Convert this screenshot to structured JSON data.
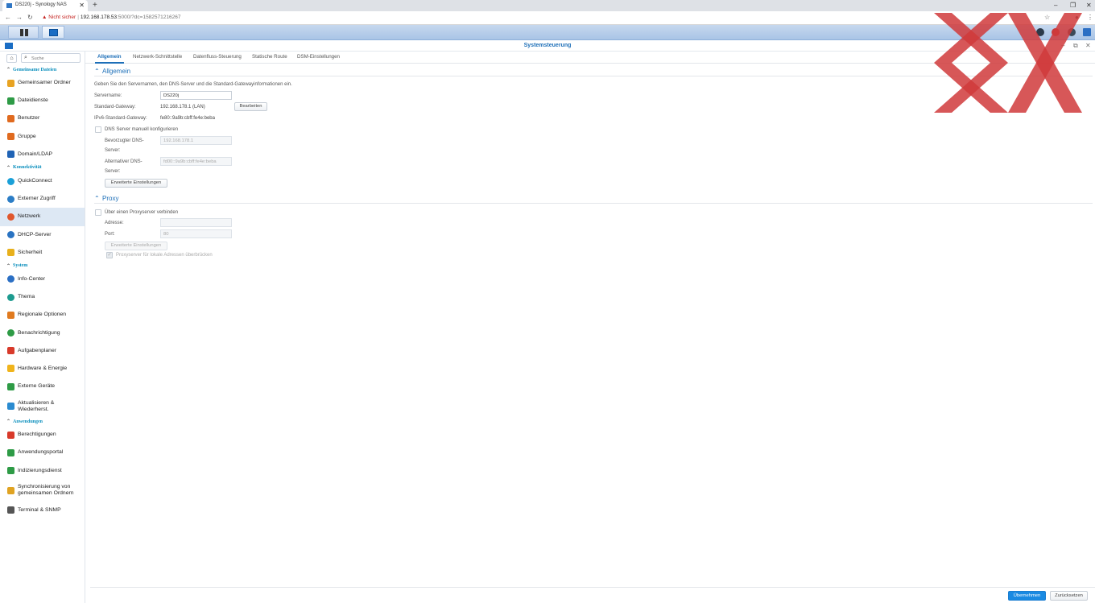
{
  "browser": {
    "tab_title": "DS220j - Synology NAS",
    "tab_close": "✕",
    "new_tab": "+",
    "window_controls": [
      "–",
      "❐",
      "✕"
    ],
    "security_label": "Nicht sicher",
    "url_host": "192.168.178.53",
    "url_rest": ":5000/?dc=1582571216267"
  },
  "window": {
    "title": "Systemsteuerung"
  },
  "sidebar": {
    "home_icon": "⌂",
    "search_placeholder": "Suche",
    "sections": [
      {
        "label": "Gemeinsame Dateien",
        "items": [
          {
            "label": "Gemeinsamer Ordner",
            "icon": "folder-icon",
            "color": "#e8a322"
          },
          {
            "label": "Dateidienste",
            "icon": "file-services-icon",
            "color": "#2e9b46"
          },
          {
            "label": "Benutzer",
            "icon": "user-icon",
            "color": "#e06a1f"
          },
          {
            "label": "Gruppe",
            "icon": "group-icon",
            "color": "#e06a1f"
          },
          {
            "label": "Domain/LDAP",
            "icon": "domain-icon",
            "color": "#2063b5"
          }
        ]
      },
      {
        "label": "Konnektivität",
        "items": [
          {
            "label": "QuickConnect",
            "icon": "quickconnect-icon",
            "color": "#1aa0d8"
          },
          {
            "label": "Externer Zugriff",
            "icon": "globe-icon",
            "color": "#2b7dc6"
          },
          {
            "label": "Netzwerk",
            "icon": "network-icon",
            "color": "#e0572d"
          },
          {
            "label": "DHCP-Server",
            "icon": "dhcp-icon",
            "color": "#2a73c2"
          },
          {
            "label": "Sicherheit",
            "icon": "shield-icon",
            "color": "#e8b01c"
          }
        ]
      },
      {
        "label": "System",
        "items": [
          {
            "label": "Info-Center",
            "icon": "info-icon",
            "color": "#2b6fc4"
          },
          {
            "label": "Thema",
            "icon": "theme-icon",
            "color": "#1d9b8f"
          },
          {
            "label": "Regionale Optionen",
            "icon": "regional-icon",
            "color": "#e07a1f"
          },
          {
            "label": "Benachrichtigung",
            "icon": "notification-icon",
            "color": "#2e9b46"
          },
          {
            "label": "Aufgabenplaner",
            "icon": "calendar-icon",
            "color": "#d83a2a"
          },
          {
            "label": "Hardware & Energie",
            "icon": "bulb-icon",
            "color": "#f0b41c"
          },
          {
            "label": "Externe Geräte",
            "icon": "external-device-icon",
            "color": "#2e9b46"
          },
          {
            "label": "Aktualisieren & Wiederherst.",
            "icon": "update-icon",
            "color": "#2a8bd0"
          }
        ]
      },
      {
        "label": "Anwendungen",
        "items": [
          {
            "label": "Berechtigungen",
            "icon": "privileges-icon",
            "color": "#d83a2a"
          },
          {
            "label": "Anwendungsportal",
            "icon": "portal-icon",
            "color": "#2e9b46"
          },
          {
            "label": "Indizierungsdienst",
            "icon": "index-icon",
            "color": "#2e9b46"
          },
          {
            "label": "Synchronisierung von gemeinsamen Ordnern",
            "icon": "sync-icon",
            "color": "#e0a322"
          },
          {
            "label": "Terminal & SNMP",
            "icon": "terminal-icon",
            "color": "#555555"
          }
        ]
      }
    ],
    "selected": "Netzwerk"
  },
  "tabs": [
    "Allgemein",
    "Netzwerk-Schnittstelle",
    "Datenfluss-Steuerung",
    "Statische Route",
    "DSM-Einstellungen"
  ],
  "general": {
    "heading": "Allgemein",
    "description": "Geben Sie den Servernamen, den DNS-Server und die Standard-Gatewayinformationen ein.",
    "server_name_label": "Servername:",
    "server_name_value": "DS220j",
    "gateway_label": "Standard-Gateway:",
    "gateway_value": "192.168.178.1 (LAN)",
    "edit_button": "Bearbeiten",
    "ipv6_gateway_label": "IPv6-Standard-Gateway:",
    "ipv6_gateway_value": "fe80::9a9b:cbff:fe4e:beba",
    "dns_manual_label": "DNS Server manuell konfigurieren",
    "preferred_dns_label_1": "Bevorzugter DNS-",
    "preferred_dns_label_2": "Server:",
    "preferred_dns_value": "192.168.178.1",
    "alternate_dns_label_1": "Alternativer DNS-",
    "alternate_dns_label_2": "Server:",
    "alternate_dns_value": "fd00::9a9b:cbff:fe4e:beba",
    "advanced_button": "Erweiterte Einstellungen"
  },
  "proxy": {
    "heading": "Proxy",
    "connect_label": "Über einen Proxyserver verbinden",
    "address_label": "Adresse:",
    "address_value": "",
    "port_label": "Port:",
    "port_value": "80",
    "advanced_button": "Erweiterte Einstellungen",
    "bypass_label": "Proxyserver für lokale Adressen überbrücken",
    "bypass_checked": true
  },
  "footer": {
    "apply": "Übernehmen",
    "reset": "Zurücksetzen"
  },
  "colors": {
    "accent": "#1d6fb8",
    "apply_button": "#1a8ae2",
    "watermark": "#d0393b"
  }
}
